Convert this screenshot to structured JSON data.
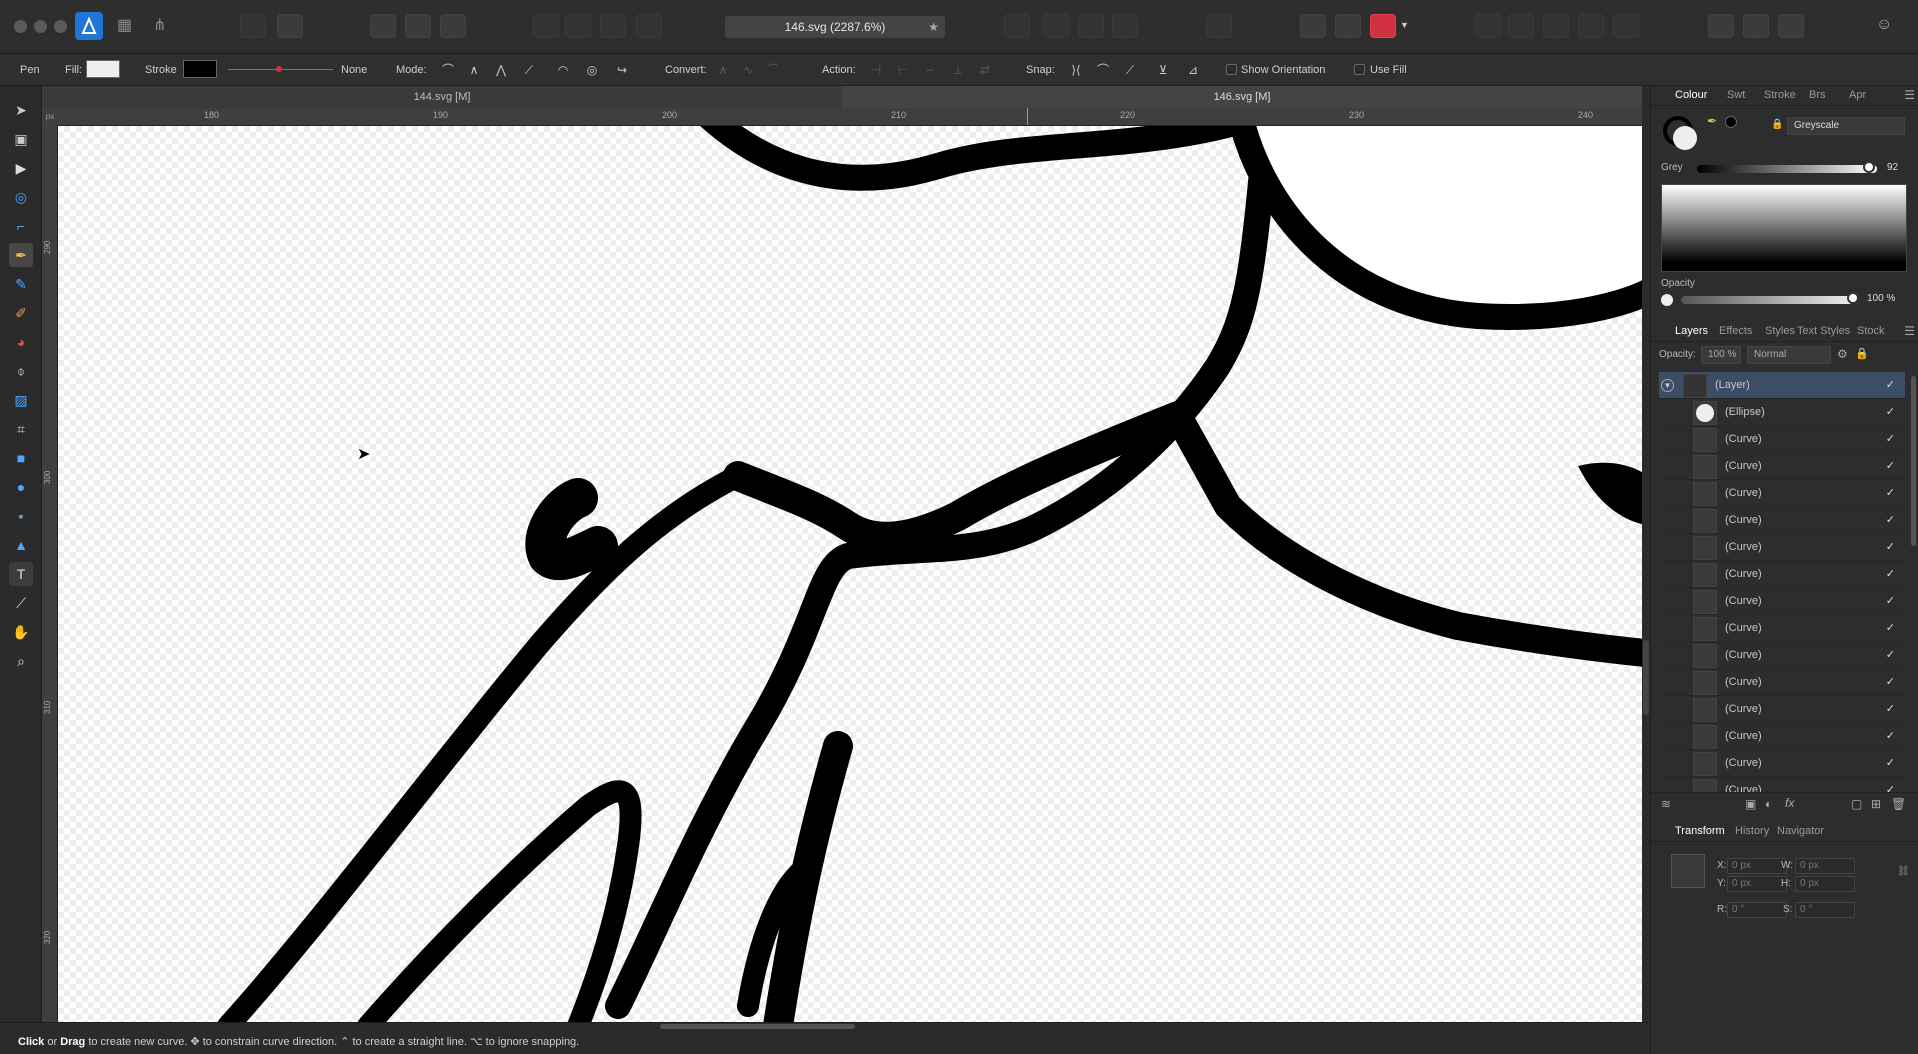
{
  "titlebar": {
    "document_title": "146.svg (2287.6%)",
    "modified_star": "★"
  },
  "context": {
    "tool_name": "Pen",
    "fill_label": "Fill:",
    "stroke_label": "Stroke",
    "stroke_width": "None",
    "mode_label": "Mode:",
    "convert_label": "Convert:",
    "action_label": "Action:",
    "snap_label": "Snap:",
    "show_orientation": "Show Orientation",
    "use_fill": "Use Fill",
    "fill_color": "#eeeeee",
    "stroke_color": "#000000"
  },
  "tabs": [
    {
      "label": "144.svg [M]"
    },
    {
      "label": "146.svg [M]"
    }
  ],
  "rulers": {
    "unit": "px",
    "top_ticks": [
      "180",
      "190",
      "200",
      "210",
      "220",
      "230",
      "240"
    ],
    "left_ticks": [
      "290",
      "300",
      "310",
      "320"
    ]
  },
  "status": {
    "click": "Click",
    "or": " or ",
    "drag": "Drag",
    "rest": " to create new curve. ✥ to constrain curve direction. ⌃ to create a straight line. ⌥ to ignore snapping."
  },
  "colour_panel": {
    "tabs": [
      "Colour",
      "Swt",
      "Stroke",
      "Brs",
      "Apr"
    ],
    "model": "Greyscale",
    "channel_label": "Grey",
    "channel_value": "92",
    "opacity_label": "Opacity",
    "opacity_value": "100 %"
  },
  "layers_panel": {
    "tabs": [
      "Layers",
      "Effects",
      "Styles",
      "Text Styles",
      "Stock"
    ],
    "opacity_label": "Opacity:",
    "opacity_value": "100 %",
    "blend_mode": "Normal",
    "rows": [
      {
        "name": "(Layer)",
        "check": "✓"
      },
      {
        "name": "(Ellipse)",
        "check": "✓"
      },
      {
        "name": "(Curve)",
        "check": "✓"
      },
      {
        "name": "(Curve)",
        "check": "✓"
      },
      {
        "name": "(Curve)",
        "check": "✓"
      },
      {
        "name": "(Curve)",
        "check": "✓"
      },
      {
        "name": "(Curve)",
        "check": "✓"
      },
      {
        "name": "(Curve)",
        "check": "✓"
      },
      {
        "name": "(Curve)",
        "check": "✓"
      },
      {
        "name": "(Curve)",
        "check": "✓"
      },
      {
        "name": "(Curve)",
        "check": "✓"
      },
      {
        "name": "(Curve)",
        "check": "✓"
      },
      {
        "name": "(Curve)",
        "check": "✓"
      },
      {
        "name": "(Curve)",
        "check": "✓"
      },
      {
        "name": "(Curve)",
        "check": "✓"
      },
      {
        "name": "(Curve)",
        "check": "✓"
      }
    ]
  },
  "transform_panel": {
    "tabs": [
      "Transform",
      "History",
      "Navigator"
    ],
    "x_label": "X:",
    "x_value": "0 px",
    "y_label": "Y:",
    "y_value": "0 px",
    "w_label": "W:",
    "w_value": "0 px",
    "h_label": "H:",
    "h_value": "0 px",
    "r_label": "R:",
    "r_value": "0 °",
    "s_label": "S:",
    "s_value": "0 °"
  }
}
